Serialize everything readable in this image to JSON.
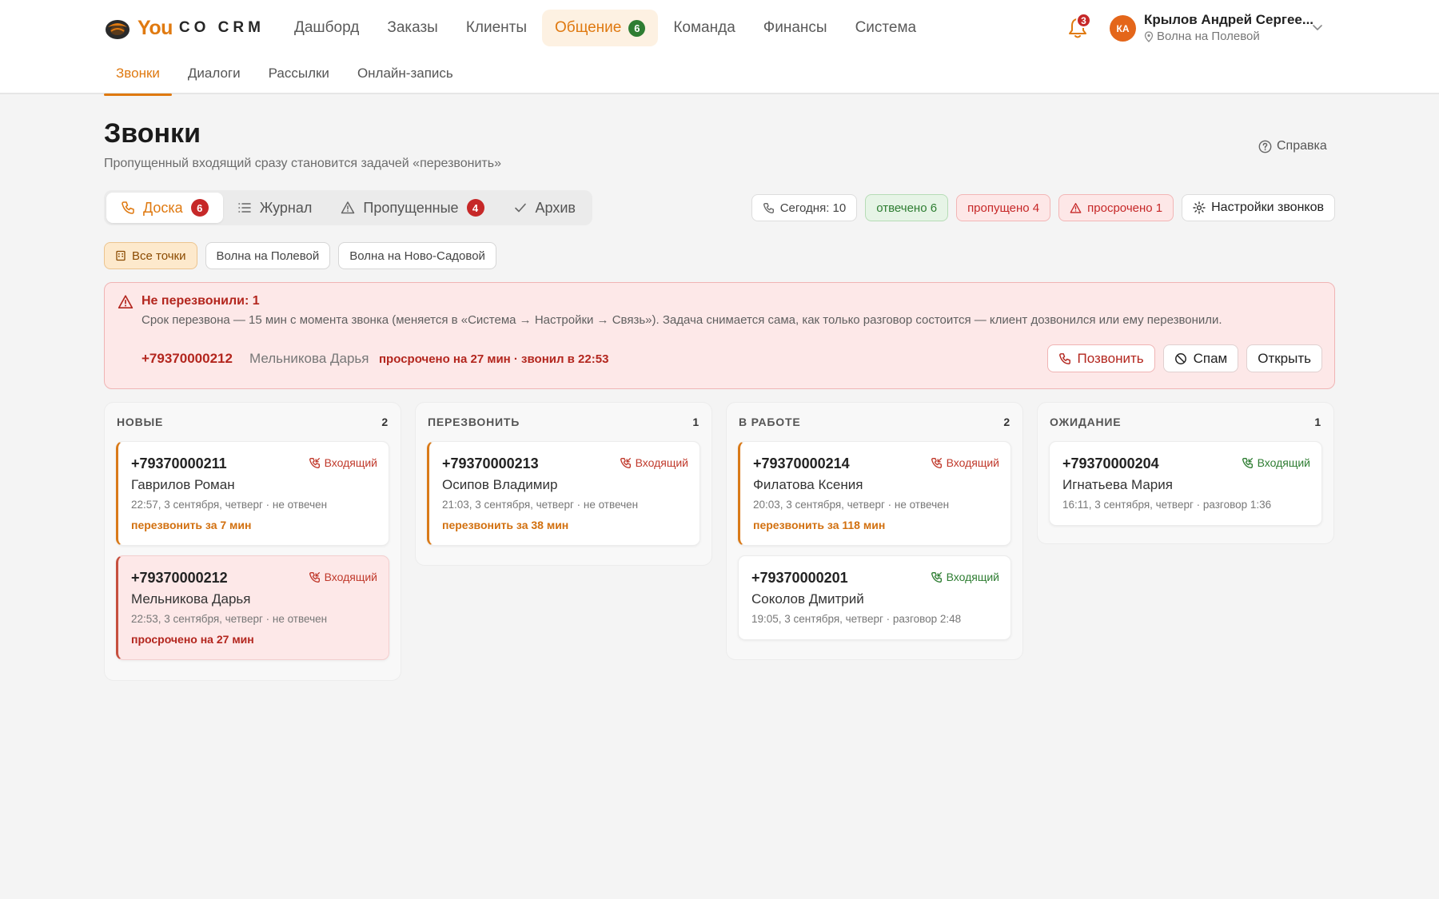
{
  "brand": {
    "you": "You",
    "co": "CO CRM"
  },
  "nav": {
    "items": [
      {
        "label": "Дашборд"
      },
      {
        "label": "Заказы"
      },
      {
        "label": "Клиенты"
      },
      {
        "label": "Общение",
        "badge": "6"
      },
      {
        "label": "Команда"
      },
      {
        "label": "Финансы"
      },
      {
        "label": "Система"
      }
    ]
  },
  "notifications": {
    "count": "3"
  },
  "user": {
    "initials": "КА",
    "name": "Крылов Андрей Сергее...",
    "location": "Волна на Полевой"
  },
  "subnav": {
    "items": [
      "Звонки",
      "Диалоги",
      "Рассылки",
      "Онлайн-запись"
    ]
  },
  "page": {
    "title": "Звонки",
    "subtitle": "Пропущенный входящий сразу становится задачей «перезвонить»",
    "help": "Справка"
  },
  "view_tabs": [
    {
      "label": "Доска",
      "badge": "6"
    },
    {
      "label": "Журнал"
    },
    {
      "label": "Пропущенные",
      "badge": "4"
    },
    {
      "label": "Архив"
    }
  ],
  "stats": {
    "today": "Сегодня: 10",
    "answered": "отвечено 6",
    "missed": "пропущено 4",
    "overdue": "просрочено 1",
    "settings": "Настройки звонков"
  },
  "locations": [
    "Все точки",
    "Волна на Полевой",
    "Волна на Ново-Садовой"
  ],
  "alert": {
    "title": "Не перезвонили: 1",
    "description": "Срок перезвона — 15 мин с момента звонка (меняется в «Система → Настройки → Связь»). Задача снимается сама, как только разговор состоится — клиент дозвонился или ему перезвонили.",
    "phone": "+79370000212",
    "name": "Мельникова Дарья",
    "overdue": "просрочено на 27 мин · звонил в 22:53",
    "actions": {
      "call": "Позвонить",
      "spam": "Спам",
      "open": "Открыть"
    }
  },
  "columns": [
    {
      "title": "НОВЫЕ",
      "count": "2",
      "cards": [
        {
          "phone": "+79370000211",
          "direction": "Входящий",
          "name": "Гаврилов Роман",
          "meta": "22:57, 3 сентября, четверг · не отвечен",
          "status": "перезвонить за 7 мин"
        },
        {
          "phone": "+79370000212",
          "direction": "Входящий",
          "name": "Мельникова Дарья",
          "meta": "22:53, 3 сентября, четверг · не отвечен",
          "status": "просрочено на 27 мин"
        }
      ]
    },
    {
      "title": "ПЕРЕЗВОНИТЬ",
      "count": "1",
      "cards": [
        {
          "phone": "+79370000213",
          "direction": "Входящий",
          "name": "Осипов Владимир",
          "meta": "21:03, 3 сентября, четверг · не отвечен",
          "status": "перезвонить за 38 мин"
        }
      ]
    },
    {
      "title": "В РАБОТЕ",
      "count": "2",
      "cards": [
        {
          "phone": "+79370000214",
          "direction": "Входящий",
          "name": "Филатова Ксения",
          "meta": "20:03, 3 сентября, четверг · не отвечен",
          "status": "перезвонить за 118 мин"
        },
        {
          "phone": "+79370000201",
          "direction": "Входящий",
          "name": "Соколов Дмитрий",
          "meta": "19:05, 3 сентября, четверг · разговор 2:48"
        }
      ]
    },
    {
      "title": "ОЖИДАНИЕ",
      "count": "1",
      "cards": [
        {
          "phone": "+79370000204",
          "direction": "Входящий",
          "name": "Игнатьева Мария",
          "meta": "16:11, 3 сентября, четверг · разговор 1:36"
        }
      ]
    }
  ],
  "colors": {
    "accent": "#df7910",
    "danger": "#c62828",
    "success": "#2e7d32"
  }
}
